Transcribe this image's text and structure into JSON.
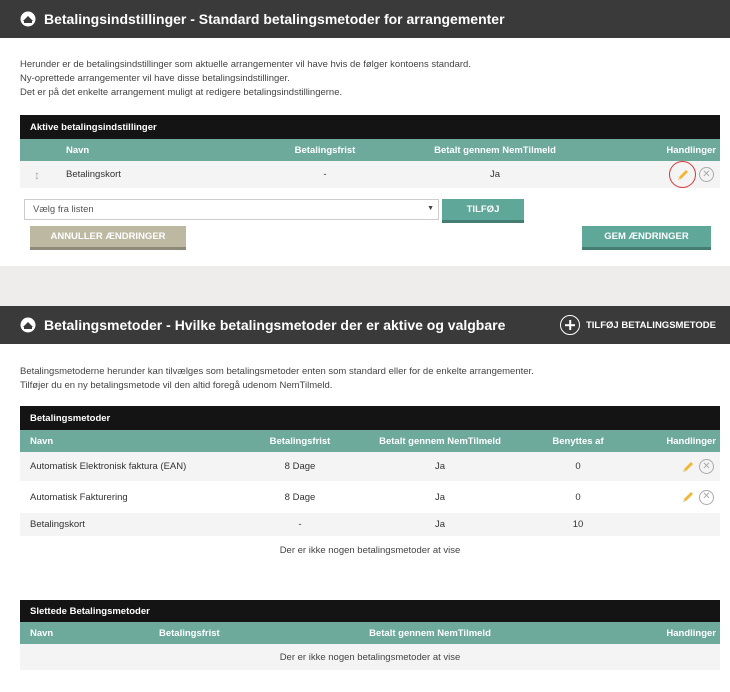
{
  "section1": {
    "title": "Betalingsindstillinger - Standard betalingsmetoder for arrangementer",
    "intro": [
      "Herunder er de betalingsindstillinger som aktuelle arrangementer vil have hvis de følger kontoens standard.",
      "Ny-oprettede arrangementer vil have disse betalingsindstillinger.",
      "Det er på det enkelte arrangement muligt at redigere betalingsindstillingerne."
    ],
    "table_title": "Aktive betalingsindstillinger",
    "columns": [
      "Navn",
      "Betalingsfrist",
      "Betalt gennem NemTilmeld",
      "Handlinger"
    ],
    "rows": [
      {
        "name": "Betalingskort",
        "frist": "-",
        "nem": "Ja"
      }
    ],
    "select_placeholder": "Vælg fra listen",
    "add_button": "TILFØJ",
    "cancel_button": "ANNULLER ÆNDRINGER",
    "save_button": "GEM ÆNDRINGER"
  },
  "section2": {
    "title": "Betalingsmetoder - Hvilke betalingsmetoder der er aktive og valgbare",
    "add_method": "TILFØJ BETALINGSMETODE",
    "intro": [
      "Betalingsmetoderne herunder kan tilvælges som betalingsmetoder enten som standard eller for de enkelte arrangementer.",
      "Tilføjer du en ny betalingsmetode vil den altid foregå udenom NemTilmeld."
    ],
    "table_title": "Betalingsmetoder",
    "columns": [
      "Navn",
      "Betalingsfrist",
      "Betalt gennem NemTilmeld",
      "Benyttes af",
      "Handlinger"
    ],
    "rows": [
      {
        "name": "Automatisk Elektronisk faktura (EAN)",
        "frist": "8 Dage",
        "nem": "Ja",
        "used": "0"
      },
      {
        "name": "Automatisk Fakturering",
        "frist": "8 Dage",
        "nem": "Ja",
        "used": "0"
      },
      {
        "name": "Betalingskort",
        "frist": "-",
        "nem": "Ja",
        "used": "10"
      }
    ],
    "empty_text": "Der er ikke nogen betalingsmetoder at vise",
    "deleted_title": "Slettede Betalingsmetoder",
    "deleted_columns": [
      "Navn",
      "Betalingsfrist",
      "Betalt gennem NemTilmeld",
      "Handlinger"
    ],
    "deleted_empty": "Der er ikke nogen betalingsmetoder at vise"
  },
  "icons": {
    "logo": "wallet-logo-icon",
    "edit": "pencil-icon",
    "delete": "close-circle-icon",
    "drag": "drag-handle-icon",
    "add": "plus-circle-icon",
    "dropdown": "caret-down-icon"
  },
  "colors": {
    "header_bg": "#3a3a3a",
    "table_head": "#6daa9c",
    "table_title": "#141414",
    "cancel": "#bcb8a2",
    "save": "#5ea799",
    "highlight": "#d9343a"
  }
}
